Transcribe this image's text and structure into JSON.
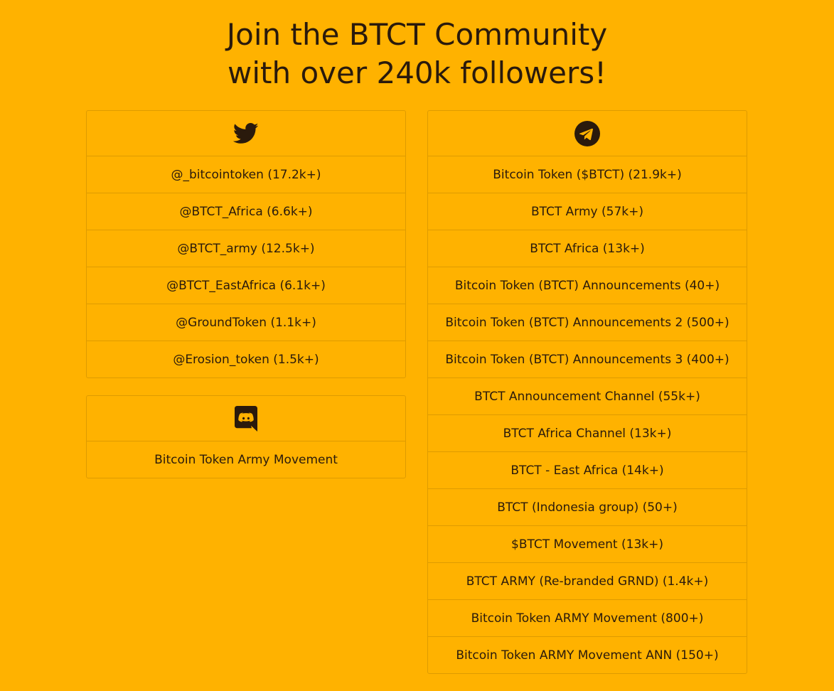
{
  "headline": {
    "line1": "Join the BTCT Community",
    "line2": "with over 240k followers!"
  },
  "colors": {
    "background": "#FFB200",
    "text": "#2a1a0c",
    "border": "rgba(0,0,0,0.13)"
  },
  "twitter": {
    "icon": "twitter-bird-icon",
    "items": [
      "@_bitcointoken (17.2k+)",
      "@BTCT_Africa (6.6k+)",
      "@BTCT_army (12.5k+)",
      "@BTCT_EastAfrica (6.1k+)",
      "@GroundToken (1.1k+)",
      "@Erosion_token (1.5k+)"
    ]
  },
  "discord": {
    "icon": "discord-icon",
    "items": [
      "Bitcoin Token Army Movement"
    ]
  },
  "telegram": {
    "icon": "telegram-icon",
    "items": [
      "Bitcoin Token ($BTCT) (21.9k+)",
      "BTCT Army (57k+)",
      "BTCT Africa (13k+)",
      "Bitcoin Token (BTCT) Announcements (40+)",
      "Bitcoin Token (BTCT) Announcements 2 (500+)",
      "Bitcoin Token (BTCT) Announcements 3 (400+)",
      "BTCT Announcement Channel (55k+)",
      "BTCT Africa Channel (13k+)",
      "BTCT - East Africa (14k+)",
      "BTCT (Indonesia group) (50+)",
      "$BTCT Movement (13k+)",
      "BTCT ARMY (Re-branded GRND) (1.4k+)",
      "Bitcoin Token ARMY Movement (800+)",
      "Bitcoin Token ARMY Movement ANN (150+)"
    ]
  }
}
